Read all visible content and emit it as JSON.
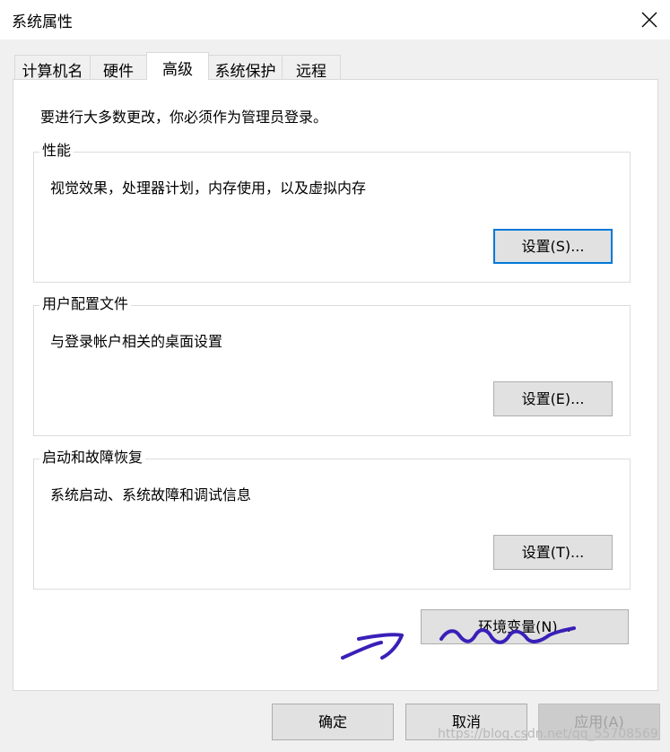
{
  "window": {
    "title": "系统属性"
  },
  "tabs": [
    {
      "label": "计算机名"
    },
    {
      "label": "硬件"
    },
    {
      "label": "高级",
      "active": true
    },
    {
      "label": "系统保护"
    },
    {
      "label": "远程"
    }
  ],
  "notice": "要进行大多数更改，你必须作为管理员登录。",
  "groups": {
    "performance": {
      "title": "性能",
      "description": "视觉效果，处理器计划，内存使用，以及虚拟内存",
      "button": "设置(S)..."
    },
    "profiles": {
      "title": "用户配置文件",
      "description": "与登录帐户相关的桌面设置",
      "button": "设置(E)..."
    },
    "startup": {
      "title": "启动和故障恢复",
      "description": "系统启动、系统故障和调试信息",
      "button": "设置(T)..."
    }
  },
  "env_button": "环境变量(N)...",
  "footer": {
    "ok": "确定",
    "cancel": "取消",
    "apply": "应用(A)"
  },
  "watermark": "https://blog.csdn.net/qq_55708569",
  "colors": {
    "focus_border": "#0078d7",
    "annotation_ink": "#3a1fb8"
  },
  "icons": {
    "close": "close-icon"
  }
}
